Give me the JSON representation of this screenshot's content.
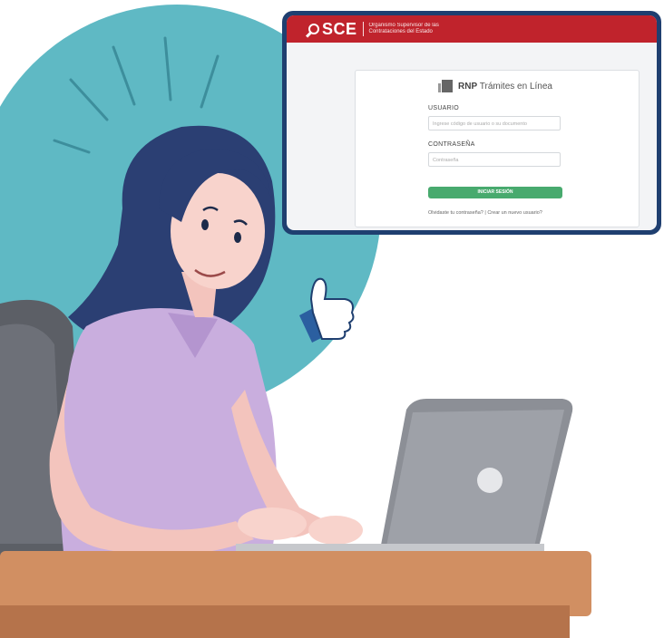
{
  "popup": {
    "header": {
      "logo": "SCE",
      "org_line1": "Organismo Supervisor de las",
      "org_line2": "Contrataciones del Estado"
    },
    "card": {
      "title_bold": "RNP",
      "title_rest": "Trámites en Línea",
      "user_label": "USUARIO",
      "user_placeholder": "Ingrese código de usuario o su documento",
      "password_label": "CONTRASEÑA",
      "password_placeholder": "Contraseña",
      "login_button": "INICIAR SESIÓN",
      "footer_links": "Olvidaste tu contraseña? | Crear un nuevo usuario?"
    }
  },
  "colors": {
    "header_red": "#c0232c",
    "frame_navy": "#1f3f70",
    "button_green": "#48aa6e",
    "circle_teal": "#5fb9c4",
    "shirt_lilac": "#c9aede",
    "desk_orange": "#d18f62",
    "hair_navy": "#2b3f73"
  },
  "icons": [
    "magnifier-logo-icon",
    "building-icon",
    "thumbs-up-icon"
  ]
}
